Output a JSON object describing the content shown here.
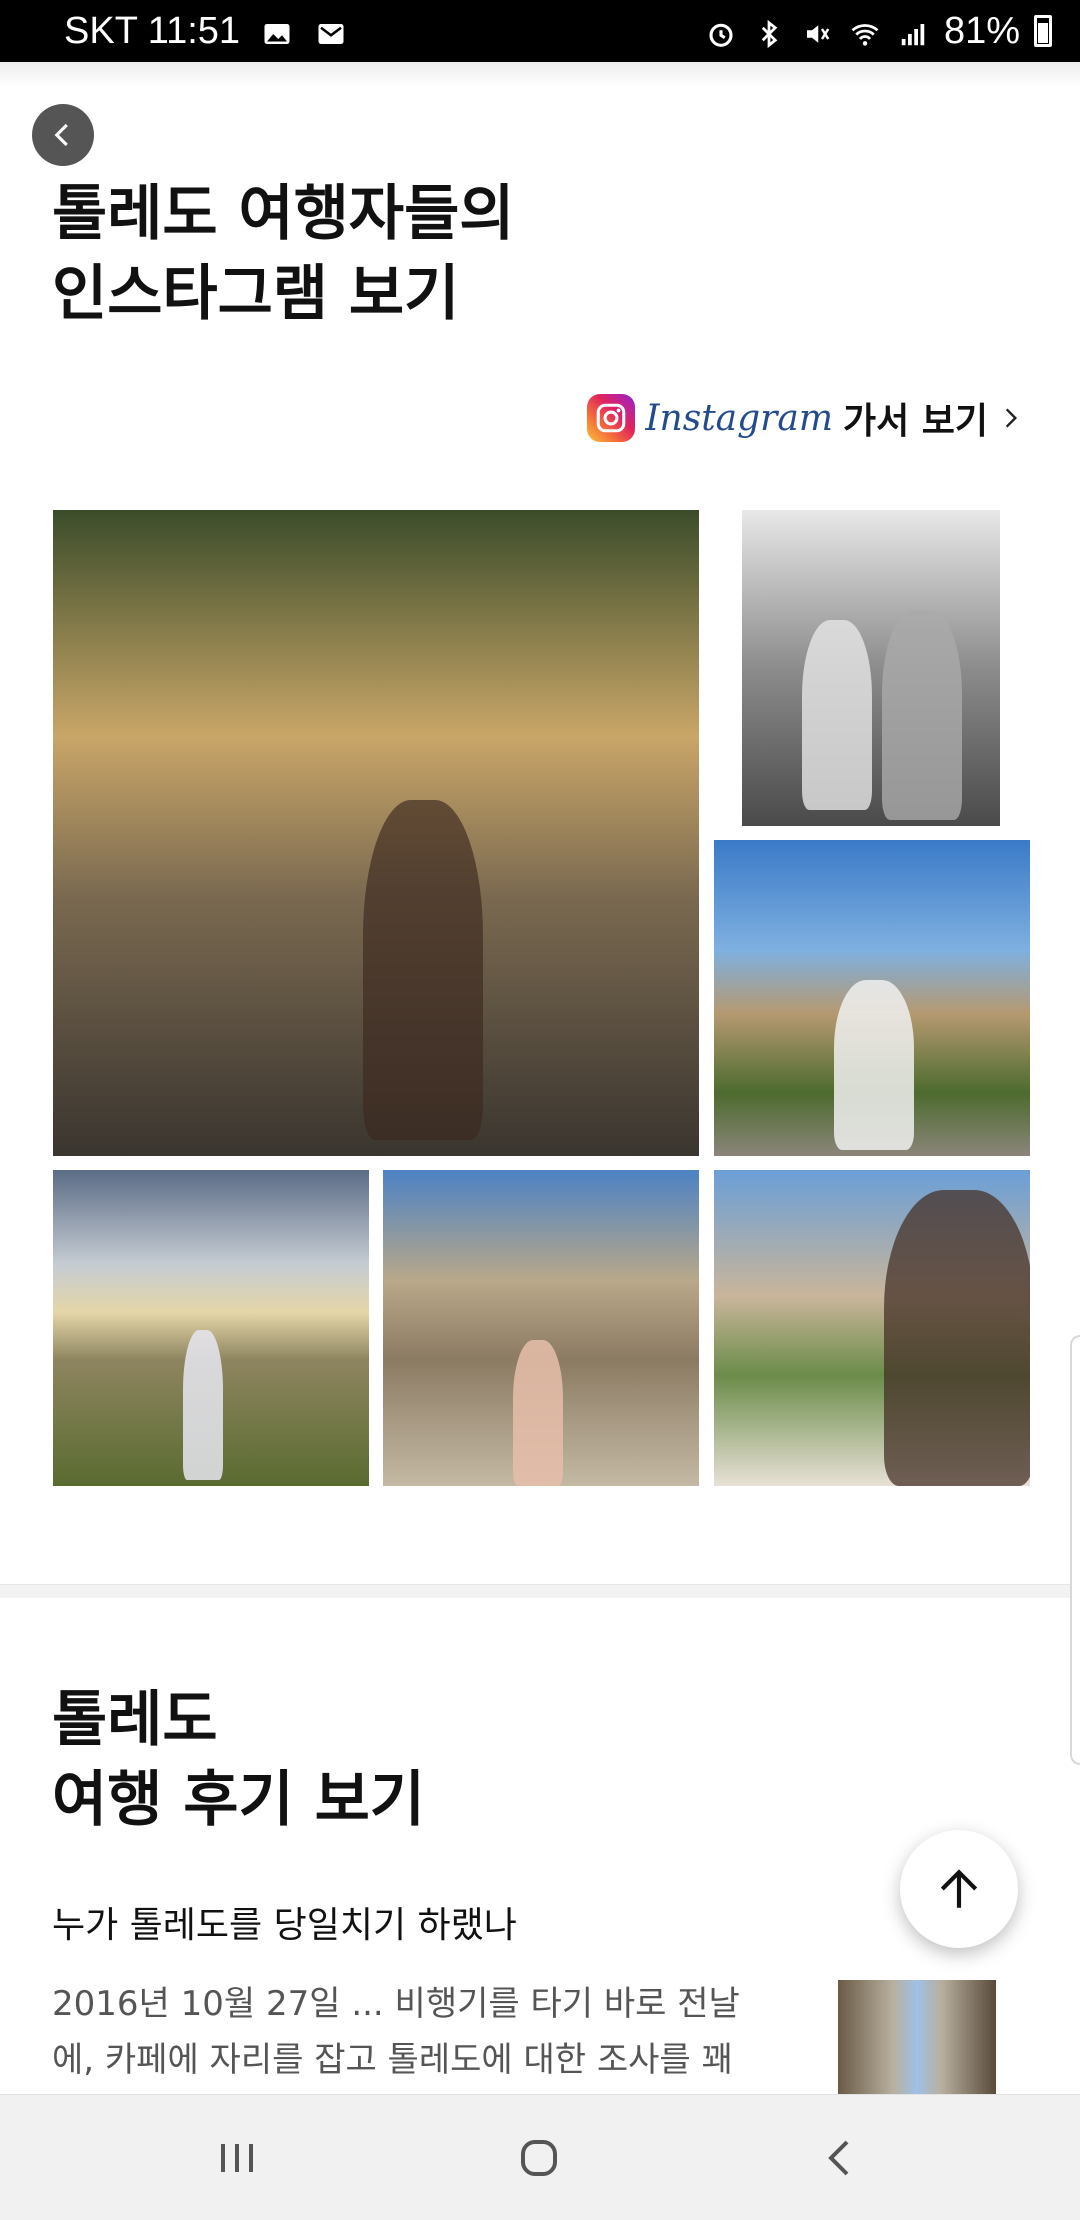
{
  "status_bar": {
    "carrier_time": "SKT 11:51",
    "battery_percent": "81%"
  },
  "back_button": {
    "icon": "chevron-left-icon"
  },
  "instagram_section": {
    "title_line1": "톨레도 여행자들의",
    "title_line2": "인스타그램 보기",
    "link_brand": "Instagram",
    "link_text": "가서 보기"
  },
  "photos": [
    {
      "alt": "cathedral-photo"
    },
    {
      "alt": "couple-alley-photo"
    },
    {
      "alt": "city-view-sitting-photo"
    },
    {
      "alt": "cloudy-city-view-photo"
    },
    {
      "alt": "palace-plaza-photo"
    },
    {
      "alt": "smiling-rooftop-photo"
    }
  ],
  "review_section": {
    "title_line1": "톨레도",
    "title_line2": "여행 후기 보기",
    "post_title": "누가 톨레도를 당일치기 하랬나",
    "post_excerpt": "2016년 10월 27일 ... 비행기를 타기 바로 전날에, 카페에 자리를 잡고 톨레도에 대한 조사를 꽤"
  },
  "scroll_top": {
    "icon": "arrow-up-icon"
  },
  "nav_bar": {
    "icons": [
      "recent-apps-icon",
      "home-icon",
      "back-icon"
    ]
  }
}
